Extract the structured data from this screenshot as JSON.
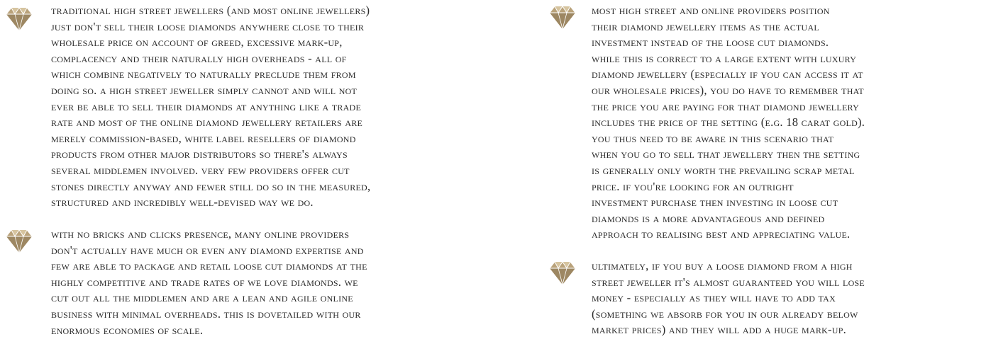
{
  "icon": {
    "name": "diamond-icon",
    "color": "#b9a27a",
    "shade": "#9d8762",
    "light": "#d6c49f"
  },
  "left_column": [
    {
      "text": "Traditional high street jewellers (and most online jewellers)\njust don't sell their loose diamonds anywhere close to their\nwholesale price on account of greed, excessive mark-up,\ncomplacency and their naturally high overheads - all of\nwhich combine negatively to naturally preclude them from\ndoing so. A high street jeweller simply cannot and will not\never be able to sell their diamonds at anything like a trade\nrate and most of the online diamond jewellery retailers are\nmerely commission-based, white label resellers of diamond\nproducts from other major distributors so there's always\nseveral middlemen involved. Very few providers offer cut\nstones directly anyway and fewer still do so in the measured,\nstructured and incredibly well-devised way we do."
    },
    {
      "text": "With no bricks and clicks presence, many online providers\ndon't actually have much or even any diamond expertise and\nfew are able to package and retail loose cut diamonds at the\nhighly competitive and trade rates of We Love Diamonds. We\ncut out all the middlemen and are a lean and agile online\nbusiness with minimal overheads. This is dovetailed with our\nenormous economies of scale."
    }
  ],
  "right_column": [
    {
      "text": "Most high street and online providers position\ntheir diamond jewellery items as the actual\ninvestment instead of the loose cut diamonds.\nWhile this is correct to a large extent with luxury\ndiamond jewellery (especially if you can access it at\nour wholesale prices), you do have to remember that\nthe price you are paying for that diamond jewellery\nincludes the price of the setting (e.g. 18 carat gold).\nYou thus need to be aware in this scenario that\nwhen you go to sell that jewellery then the setting\nis generally only worth the prevailing scrap metal\nprice. If you're looking for an outright\ninvestment purchase then investing in loose cut\ndiamonds is a more advantageous and defined\napproach to realising best and appreciating value."
    },
    {
      "text": "Ultimately, if you buy a loose diamond from a high\nstreet jeweller it's almost guaranteed you will lose\nmoney - especially as they will have to add tax\n(something we absorb for you in our already below\nmarket prices) and they will add a huge mark-up."
    }
  ]
}
